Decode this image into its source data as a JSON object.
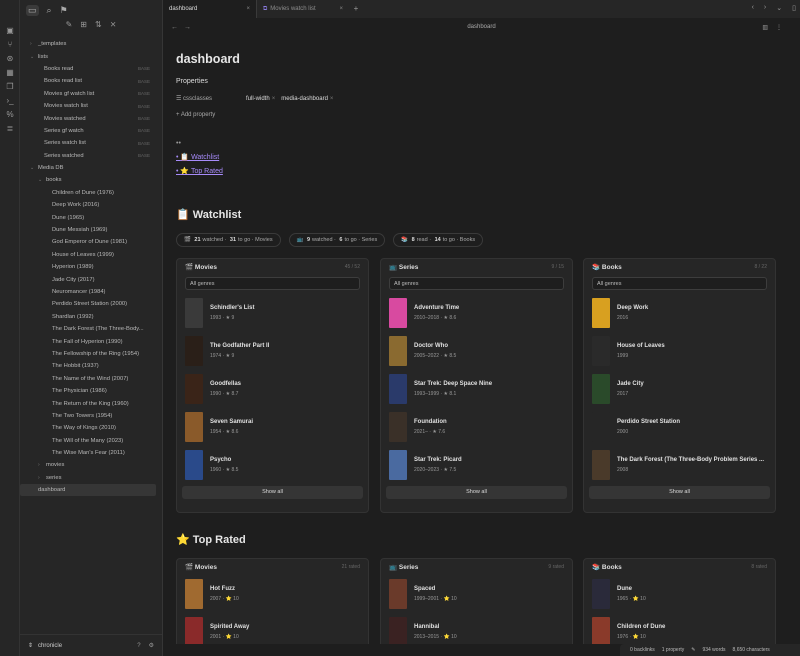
{
  "ribbon": {
    "icons": [
      "folder-open-icon",
      "git-branch-icon",
      "graph-icon",
      "calendar-icon",
      "copy-icon",
      "terminal-icon",
      "percent-icon",
      "database-icon"
    ]
  },
  "sidebar": {
    "tree": [
      {
        "label": "_templates",
        "depth": 0,
        "caret": "›"
      },
      {
        "label": "lists",
        "depth": 0,
        "caret": "⌄"
      },
      {
        "label": "Books read",
        "depth": 1,
        "badge": "BASE"
      },
      {
        "label": "Books read list",
        "depth": 1,
        "badge": "BASE"
      },
      {
        "label": "Movies gf watch list",
        "depth": 1,
        "badge": "BASE"
      },
      {
        "label": "Movies watch list",
        "depth": 1,
        "badge": "BASE"
      },
      {
        "label": "Movies watched",
        "depth": 1,
        "badge": "BASE"
      },
      {
        "label": "Series gf watch",
        "depth": 1,
        "badge": "BASE"
      },
      {
        "label": "Series watch list",
        "depth": 1,
        "badge": "BASE"
      },
      {
        "label": "Series watched",
        "depth": 1,
        "badge": "BASE"
      },
      {
        "label": "Media DB",
        "depth": 0,
        "caret": "⌄"
      },
      {
        "label": "books",
        "depth": 1,
        "caret": "⌄"
      },
      {
        "label": "Children of Dune (1976)",
        "depth": 2
      },
      {
        "label": "Deep Work (2016)",
        "depth": 2
      },
      {
        "label": "Dune (1965)",
        "depth": 2
      },
      {
        "label": "Dune Messiah (1969)",
        "depth": 2
      },
      {
        "label": "God Emperor of Dune (1981)",
        "depth": 2
      },
      {
        "label": "House of Leaves (1999)",
        "depth": 2
      },
      {
        "label": "Hyperion (1989)",
        "depth": 2
      },
      {
        "label": "Jade City (2017)",
        "depth": 2
      },
      {
        "label": "Neuromancer (1984)",
        "depth": 2
      },
      {
        "label": "Perdido Street Station (2000)",
        "depth": 2
      },
      {
        "label": "Shardlan (1992)",
        "depth": 2
      },
      {
        "label": "The Dark Forest (The Three-Body...",
        "depth": 2
      },
      {
        "label": "The Fall of Hyperion (1990)",
        "depth": 2
      },
      {
        "label": "The Fellowship of the Ring (1954)",
        "depth": 2
      },
      {
        "label": "The Hobbit (1937)",
        "depth": 2
      },
      {
        "label": "The Name of the Wind (2007)",
        "depth": 2
      },
      {
        "label": "The Physician (1986)",
        "depth": 2
      },
      {
        "label": "The Return of the King (1960)",
        "depth": 2
      },
      {
        "label": "The Two Towers (1954)",
        "depth": 2
      },
      {
        "label": "The Way of Kings (2010)",
        "depth": 2
      },
      {
        "label": "The Will of the Many (2023)",
        "depth": 2
      },
      {
        "label": "The Wise Man's Fear (2011)",
        "depth": 2
      },
      {
        "label": "movies",
        "depth": 1,
        "caret": "›"
      },
      {
        "label": "series",
        "depth": 1,
        "caret": "›"
      },
      {
        "label": "dashboard",
        "depth": 0,
        "selected": true
      }
    ],
    "vault": "chronicle"
  },
  "tabs": [
    {
      "label": "dashboard",
      "active": true
    },
    {
      "label": "Movies watch list",
      "active": false
    }
  ],
  "view": {
    "title": "dashboard"
  },
  "page": {
    "title": "dashboard",
    "properties_label": "Properties",
    "prop_key": "cssclasses",
    "prop_values": [
      "full-width",
      "media-dashboard"
    ],
    "add_property": "Add property",
    "dots": "••",
    "toc": [
      "📋 Watchlist",
      "⭐ Top Rated"
    ],
    "watchlist_heading": "📋 Watchlist",
    "toprated_heading": "⭐ Top Rated",
    "stats": [
      {
        "icon": "🎬",
        "a": "21",
        "a_lbl": "watched ·",
        "b": "31",
        "b_lbl": "to go · Movies"
      },
      {
        "icon": "📺",
        "a": "9",
        "a_lbl": "watched ·",
        "b": "6",
        "b_lbl": "to go · Series"
      },
      {
        "icon": "📚",
        "a": "8",
        "a_lbl": "read ·",
        "b": "14",
        "b_lbl": "to go · Books"
      }
    ]
  },
  "watchlist": [
    {
      "title": "🎬 Movies",
      "count": "45 / 52",
      "genre": "All genres",
      "show_all": "Show all",
      "items": [
        {
          "title": "Schindler's List",
          "meta": "1993 · ★ 9",
          "color": "#3a3a3a"
        },
        {
          "title": "The Godfather Part II",
          "meta": "1974 · ★ 9",
          "color": "#2a1f18"
        },
        {
          "title": "Goodfellas",
          "meta": "1990 · ★ 8.7",
          "color": "#3a2418"
        },
        {
          "title": "Seven Samurai",
          "meta": "1954 · ★ 8.6",
          "color": "#8a5a2a"
        },
        {
          "title": "Psycho",
          "meta": "1960 · ★ 8.5",
          "color": "#2a4a8a"
        }
      ]
    },
    {
      "title": "📺 Series",
      "count": "9 / 15",
      "genre": "All genres",
      "show_all": "Show all",
      "items": [
        {
          "title": "Adventure Time",
          "meta": "2010–2018 · ★ 8.6",
          "color": "#d84aa0"
        },
        {
          "title": "Doctor Who",
          "meta": "2005–2022 · ★ 8.5",
          "color": "#8a6a30"
        },
        {
          "title": "Star Trek: Deep Space Nine",
          "meta": "1993–1999 · ★ 8.1",
          "color": "#2a3a6a"
        },
        {
          "title": "Foundation",
          "meta": "2021– · ★ 7.6",
          "color": "#3a3028"
        },
        {
          "title": "Star Trek: Picard",
          "meta": "2020–2023 · ★ 7.5",
          "color": "#4a6aa0"
        }
      ]
    },
    {
      "title": "📚 Books",
      "count": "8 / 22",
      "genre": "All genres",
      "show_all": "Show all",
      "items": [
        {
          "title": "Deep Work",
          "meta": "2016",
          "color": "#d8a020"
        },
        {
          "title": "House of Leaves",
          "meta": "1999",
          "color": "#2a2a2a"
        },
        {
          "title": "Jade City",
          "meta": "2017",
          "color": "#2a4a2a"
        },
        {
          "title": "Perdido Street Station",
          "meta": "2000",
          "color": "#262626"
        },
        {
          "title": "The Dark Forest (The Three-Body Problem Series ...",
          "meta": "2008",
          "color": "#4a3a2a"
        }
      ]
    }
  ],
  "toprated": [
    {
      "title": "🎬 Movies",
      "count": "21 rated",
      "items": [
        {
          "title": "Hot Fuzz",
          "meta": "2007 · ⭐ 10",
          "color": "#a06a30"
        },
        {
          "title": "Spirited Away",
          "meta": "2001 · ⭐ 10",
          "color": "#8a2a2a"
        }
      ]
    },
    {
      "title": "📺 Series",
      "count": "9 rated",
      "items": [
        {
          "title": "Spaced",
          "meta": "1999–2001 · ⭐ 10",
          "color": "#6a3a2a"
        },
        {
          "title": "Hannibal",
          "meta": "2013–2015 · ⭐ 10",
          "color": "#3a2222"
        }
      ]
    },
    {
      "title": "📚 Books",
      "count": "8 rated",
      "items": [
        {
          "title": "Dune",
          "meta": "1965 · ⭐ 10",
          "color": "#2a2a3a"
        },
        {
          "title": "Children of Dune",
          "meta": "1976 · ⭐ 10",
          "color": "#8a3a2a"
        }
      ]
    }
  ],
  "status": {
    "backlinks": "0 backlinks",
    "property": "1 property",
    "words": "934 words",
    "chars": "8,650 characters"
  }
}
